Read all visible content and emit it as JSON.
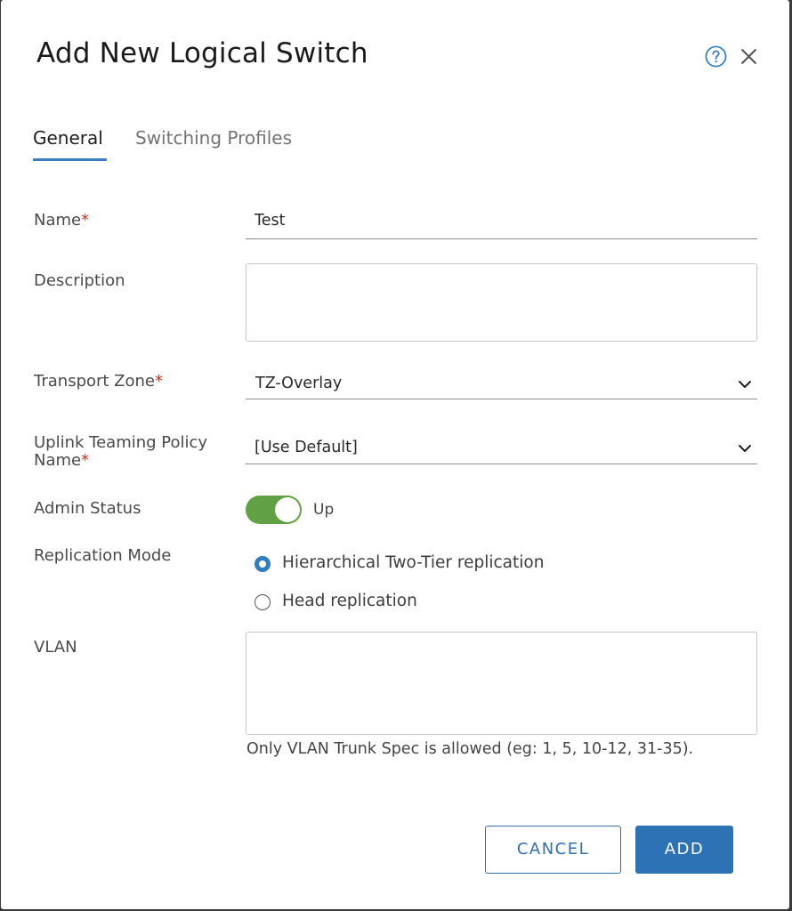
{
  "dialog": {
    "title": "Add New Logical Switch",
    "help_icon": "help-circle-icon",
    "close_icon": "close-icon"
  },
  "tabs": [
    {
      "label": "General",
      "active": true
    },
    {
      "label": "Switching Profiles",
      "active": false
    }
  ],
  "form": {
    "required_marker": "*",
    "name": {
      "label": "Name",
      "value": "Test",
      "required": true
    },
    "description": {
      "label": "Description",
      "value": ""
    },
    "transport_zone": {
      "label": "Transport Zone",
      "value": "TZ-Overlay",
      "required": true
    },
    "uplink_teaming": {
      "label_line1": "Uplink Teaming Policy",
      "label_line2": "Name",
      "value": "[Use Default]",
      "required": true
    },
    "admin_status": {
      "label": "Admin Status",
      "state_label": "Up",
      "on": true
    },
    "replication_mode": {
      "label": "Replication Mode",
      "options": [
        {
          "label": "Hierarchical Two-Tier replication",
          "selected": true
        },
        {
          "label": "Head replication",
          "selected": false
        }
      ]
    },
    "vlan": {
      "label": "VLAN",
      "value": "",
      "hint": "Only VLAN Trunk Spec is allowed (eg: 1, 5, 10-12, 31-35)."
    }
  },
  "buttons": {
    "cancel": "CANCEL",
    "add": "ADD"
  },
  "colors": {
    "accent": "#2e72b6",
    "toggle_on": "#62a045",
    "required": "#c2361e"
  }
}
